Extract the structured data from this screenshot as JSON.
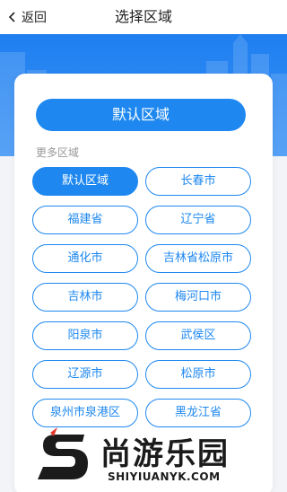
{
  "nav": {
    "back_label": "返回",
    "title": "选择区域"
  },
  "default_button": "默认区域",
  "section_label": "更多区域",
  "regions": [
    {
      "label": "默认区域",
      "active": true
    },
    {
      "label": "长春市",
      "active": false
    },
    {
      "label": "福建省",
      "active": false
    },
    {
      "label": "辽宁省",
      "active": false
    },
    {
      "label": "通化市",
      "active": false
    },
    {
      "label": "吉林省松原市",
      "active": false
    },
    {
      "label": "吉林市",
      "active": false
    },
    {
      "label": "梅河口市",
      "active": false
    },
    {
      "label": "阳泉市",
      "active": false
    },
    {
      "label": "武侯区",
      "active": false
    },
    {
      "label": "辽源市",
      "active": false
    },
    {
      "label": "松原市",
      "active": false
    },
    {
      "label": "泉州市泉港区",
      "active": false
    },
    {
      "label": "黑龙江省",
      "active": false
    }
  ],
  "watermark": {
    "name_cn": "尚游乐园",
    "name_en": "SHIYIUANYK.COM"
  },
  "colors": {
    "accent": "#1e88f0",
    "banner": "#2a86f2"
  }
}
